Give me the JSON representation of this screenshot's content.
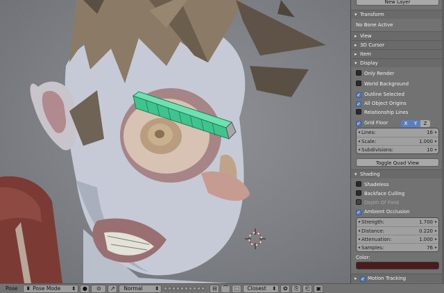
{
  "viewport": {
    "tag": "Pose"
  },
  "panel": {
    "new_layer_button": "New Layer",
    "transform": {
      "title": "Transform",
      "status": "No Bone Active"
    },
    "collapsed_sections": [
      "View",
      "3D Cursor",
      "Item"
    ],
    "display": {
      "title": "Display",
      "options": [
        {
          "label": "Only Render",
          "checked": false
        },
        {
          "label": "World Background",
          "checked": false
        },
        {
          "label": "Outline Selected",
          "checked": true
        },
        {
          "label": "All Object Origins",
          "checked": true
        },
        {
          "label": "Relationship Lines",
          "checked": false
        }
      ],
      "grid_floor": {
        "label": "Grid Floor",
        "checked": true,
        "axes": [
          "X",
          "Y",
          "Z"
        ]
      },
      "grid_fields": [
        {
          "label": "Lines:",
          "value": "16"
        },
        {
          "label": "Scale:",
          "value": "1.000"
        },
        {
          "label": "Subdivisions:",
          "value": "10"
        }
      ],
      "toggle_quad_view": "Toggle Quad View"
    },
    "shading": {
      "title": "Shading",
      "options": [
        {
          "label": "Shadeless",
          "checked": false,
          "disabled": false
        },
        {
          "label": "Backface Culling",
          "checked": false,
          "disabled": false
        },
        {
          "label": "Depth Of Field",
          "checked": false,
          "disabled": true
        },
        {
          "label": "Ambient Occlusion",
          "checked": true,
          "disabled": false
        }
      ],
      "ao_fields": [
        {
          "label": "Strength:",
          "value": "1.700"
        },
        {
          "label": "Distance:",
          "value": "0.220"
        },
        {
          "label": "Attenuation:",
          "value": "1.000"
        },
        {
          "label": "Samples:",
          "value": "76"
        }
      ],
      "color_label": "Color:",
      "color_value": "#4a1b1d"
    },
    "motion_tracking": "Motion Tracking"
  },
  "header": {
    "pose_label": "Pose",
    "mode": "Pose Mode",
    "pivot": "Normal",
    "snap": "Closest"
  }
}
